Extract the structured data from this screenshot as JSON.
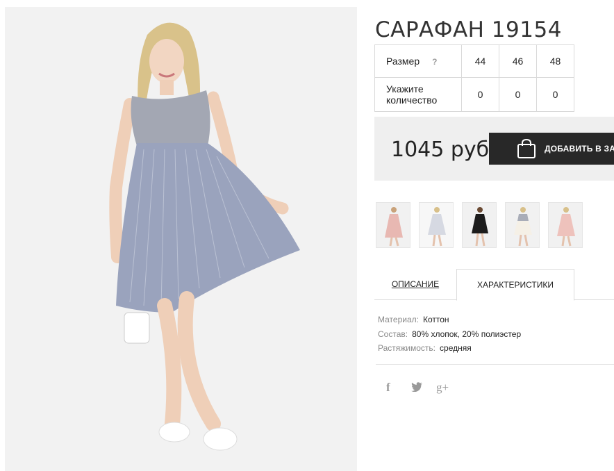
{
  "product": {
    "title": "САРАФАН 19154"
  },
  "sizes": {
    "header_label": "Размер",
    "help_mark": "?",
    "values": [
      "44",
      "46",
      "48"
    ],
    "quantity_label_line1": "Укажите",
    "quantity_label_line2": "количество",
    "quantities": [
      "0",
      "0",
      "0"
    ]
  },
  "purchase": {
    "price": "1045 руб",
    "add_to_cart_label": "ДОБАВИТЬ В ЗА"
  },
  "thumbnails": [
    {
      "color": "#e8b8b2",
      "icon": "dress-pink"
    },
    {
      "color": "#d6d9e2",
      "icon": "dress-grey"
    },
    {
      "color": "#1c1c1c",
      "icon": "dress-black"
    },
    {
      "color": "#f5f0e6",
      "icon": "dress-white-grey"
    },
    {
      "color": "#eec2bc",
      "icon": "dress-pink-light"
    }
  ],
  "tabs": {
    "description": "ОПИСАНИЕ",
    "characteristics": "ХАРАКТЕРИСТИКИ"
  },
  "specs": {
    "material_label": "Материал:",
    "material_value": "Коттон",
    "composition_label": "Состав:",
    "composition_value": "80% хлопок, 20% полиэстер",
    "stretch_label": "Растяжимость:",
    "stretch_value": "средняя"
  },
  "social": {
    "facebook": "f",
    "twitter": "twitter-bird",
    "google_plus": "g+"
  }
}
